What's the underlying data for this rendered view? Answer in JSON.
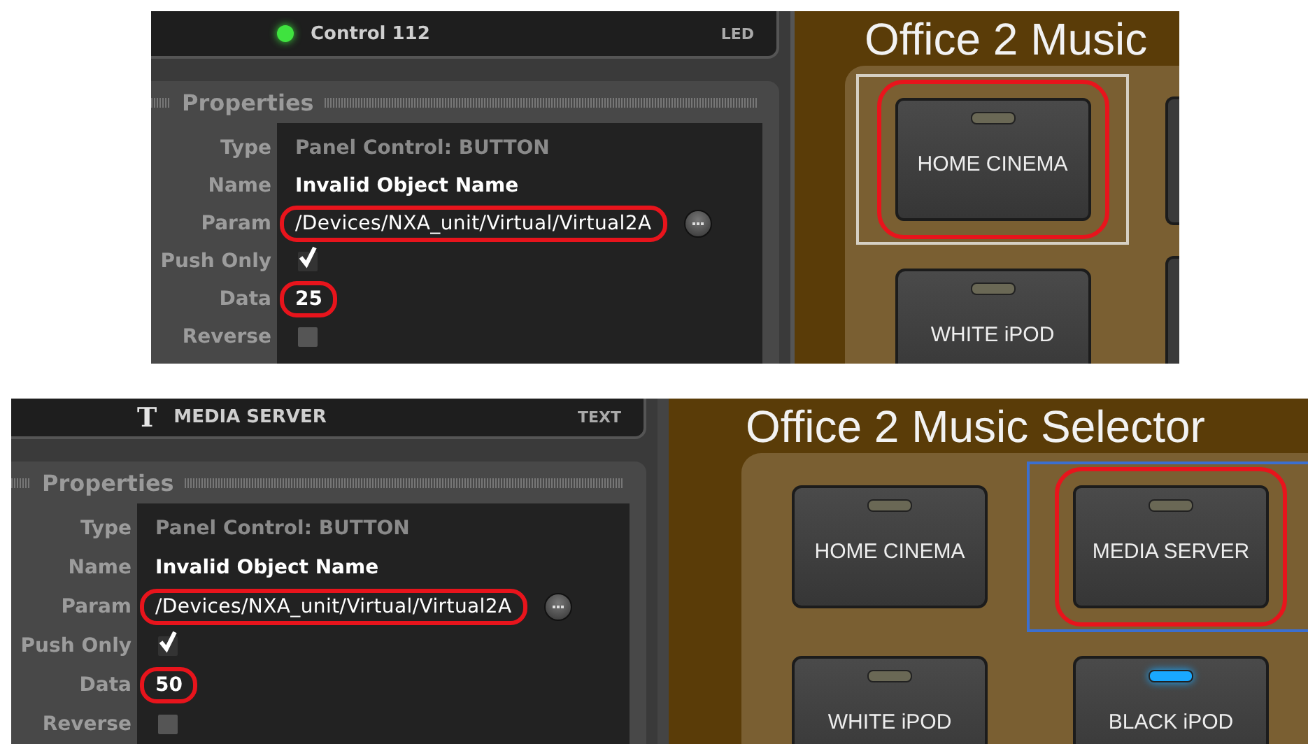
{
  "snapshots": [
    {
      "header": {
        "kind": "led",
        "title": "Control 112",
        "type_tag": "LED"
      },
      "properties": {
        "heading": "Properties",
        "rows": [
          {
            "kind": "readonly",
            "label": "Type",
            "value": "Panel Control: BUTTON"
          },
          {
            "kind": "text",
            "label": "Name",
            "value": "Invalid Object Name"
          },
          {
            "kind": "path",
            "label": "Param",
            "value": "/Devices/NXA_unit/Virtual/Virtual2A",
            "highlighted": true
          },
          {
            "kind": "checkbox",
            "label": "Push Only",
            "checked": true
          },
          {
            "kind": "text",
            "label": "Data",
            "value": "25",
            "highlighted": true
          },
          {
            "kind": "checkbox",
            "label": "Reverse",
            "checked": false
          }
        ]
      },
      "preview": {
        "title": "Office 2 Music",
        "cropped": true,
        "buttons": [
          {
            "label": "HOME CINEMA",
            "led_on": false,
            "selected": true,
            "highlighted": true
          },
          {
            "label": "WHITE iPOD",
            "led_on": false,
            "selected": false
          }
        ]
      }
    },
    {
      "header": {
        "kind": "text",
        "glyph": "T",
        "title": "MEDIA SERVER",
        "type_tag": "TEXT"
      },
      "properties": {
        "heading": "Properties",
        "rows": [
          {
            "kind": "readonly",
            "label": "Type",
            "value": "Panel Control: BUTTON"
          },
          {
            "kind": "text",
            "label": "Name",
            "value": "Invalid Object Name"
          },
          {
            "kind": "path",
            "label": "Param",
            "value": "/Devices/NXA_unit/Virtual/Virtual2A",
            "highlighted": true
          },
          {
            "kind": "checkbox",
            "label": "Push Only",
            "checked": true
          },
          {
            "kind": "text",
            "label": "Data",
            "value": "50",
            "highlighted": true
          },
          {
            "kind": "checkbox",
            "label": "Reverse",
            "checked": false
          }
        ]
      },
      "preview": {
        "title": "Office 2 Music Selector",
        "buttons": [
          {
            "label": "HOME CINEMA",
            "led_on": false,
            "selected": false
          },
          {
            "label": "MEDIA SERVER",
            "led_on": false,
            "selected": true,
            "highlighted": true
          },
          {
            "label": "WHITE iPOD",
            "led_on": false,
            "selected": false
          },
          {
            "label": "BLACK iPOD",
            "led_on": true,
            "selected": false
          }
        ]
      }
    }
  ]
}
